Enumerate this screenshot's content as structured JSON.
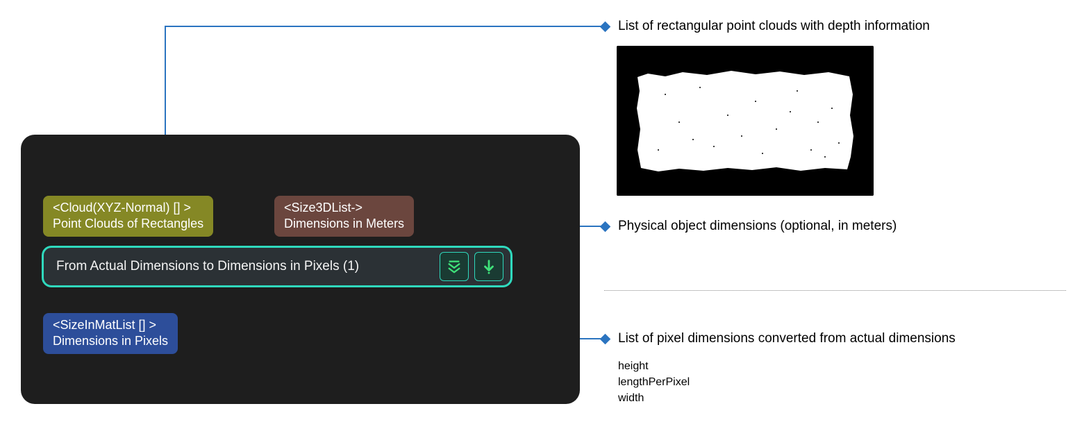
{
  "panel": {
    "cloud": {
      "type": "<Cloud(XYZ-Normal) [] >",
      "label": "Point Clouds of Rectangles"
    },
    "size3d": {
      "type": "<Size3DList->",
      "label": "Dimensions in Meters"
    },
    "action_label": "From Actual Dimensions to Dimensions in Pixels (1)",
    "sizeinmat": {
      "type": "<SizeInMatList [] >",
      "label": "Dimensions in Pixels"
    }
  },
  "annotations": {
    "cloud_desc": "List of rectangular point clouds with depth information",
    "size3d_desc": "Physical object dimensions (optional, in meters)",
    "sizeinmat_desc": "List of pixel dimensions converted from actual dimensions",
    "subfields": [
      "height",
      "lengthPerPixel",
      "width"
    ]
  }
}
